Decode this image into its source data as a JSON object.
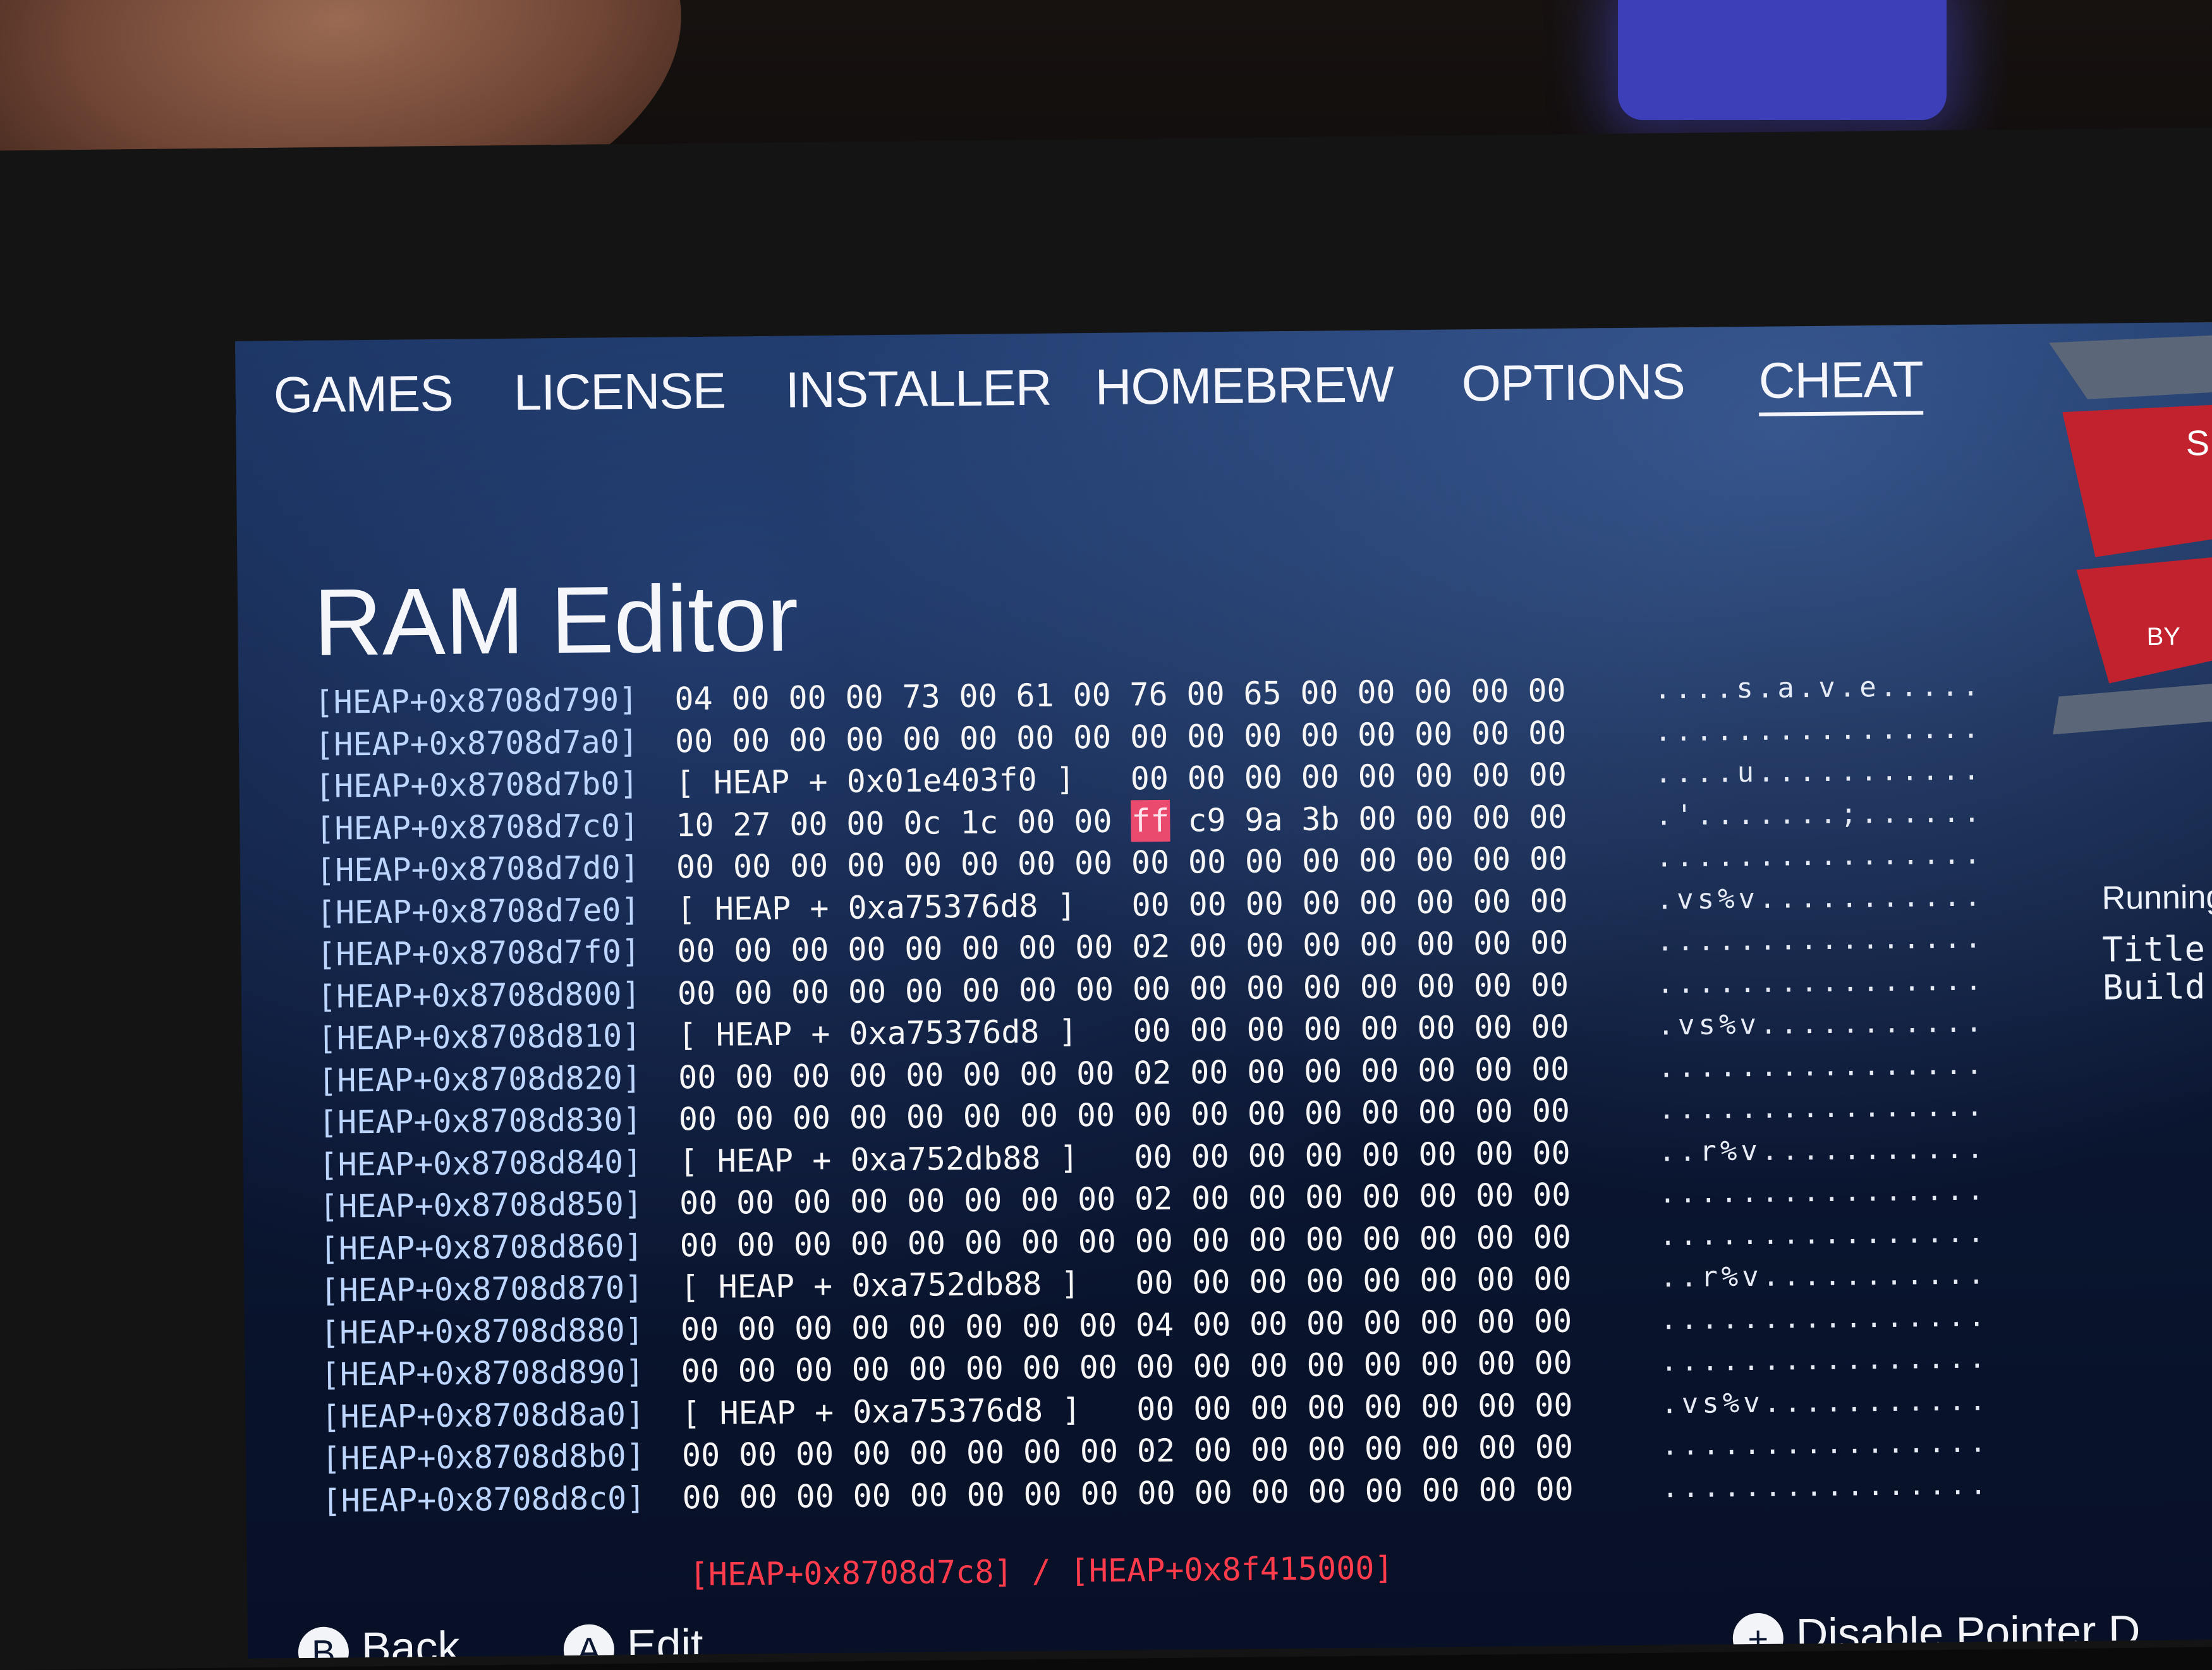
{
  "tabs": [
    {
      "label": "GAMES",
      "active": false
    },
    {
      "label": "LICENSE",
      "active": false
    },
    {
      "label": "INSTALLER",
      "active": false
    },
    {
      "label": "HOMEBREW",
      "active": false
    },
    {
      "label": "OPTIONS",
      "active": false
    },
    {
      "label": "CHEAT",
      "active": true
    }
  ],
  "page_title": "RAM Editor",
  "side_panel": {
    "logo_text_partial": "S",
    "logo_sub_partial": "BY",
    "running_label": "Running",
    "title_label": "Title",
    "build_label": "Build"
  },
  "hex_rows": [
    {
      "addr": "[HEAP+0x8708d790]",
      "bytes": [
        "04",
        "00",
        "00",
        "00",
        "73",
        "00",
        "61",
        "00",
        "76",
        "00",
        "65",
        "00",
        "00",
        "00",
        "00",
        "00"
      ],
      "ascii": "....s.a.v.e....."
    },
    {
      "addr": "[HEAP+0x8708d7a0]",
      "bytes": [
        "00",
        "00",
        "00",
        "00",
        "00",
        "00",
        "00",
        "00",
        "00",
        "00",
        "00",
        "00",
        "00",
        "00",
        "00",
        "00"
      ],
      "ascii": "................"
    },
    {
      "addr": "[HEAP+0x8708d7b0]",
      "pointer": "[  HEAP + 0x01e403f0  ]",
      "bytes": [
        "00",
        "00",
        "00",
        "00",
        "00",
        "00",
        "00",
        "00"
      ],
      "ascii": "....u..........."
    },
    {
      "addr": "[HEAP+0x8708d7c0]",
      "bytes": [
        "10",
        "27",
        "00",
        "00",
        "0c",
        "1c",
        "00",
        "00",
        "ff",
        "c9",
        "9a",
        "3b",
        "00",
        "00",
        "00",
        "00"
      ],
      "selected_index": 8,
      "ascii": ".'.......;......",
      "ascii_selected_index": 8
    },
    {
      "addr": "[HEAP+0x8708d7d0]",
      "bytes": [
        "00",
        "00",
        "00",
        "00",
        "00",
        "00",
        "00",
        "00",
        "00",
        "00",
        "00",
        "00",
        "00",
        "00",
        "00",
        "00"
      ],
      "ascii": "................"
    },
    {
      "addr": "[HEAP+0x8708d7e0]",
      "pointer": "[  HEAP + 0xa75376d8  ]",
      "bytes": [
        "00",
        "00",
        "00",
        "00",
        "00",
        "00",
        "00",
        "00"
      ],
      "ascii": ".vs%v..........."
    },
    {
      "addr": "[HEAP+0x8708d7f0]",
      "bytes": [
        "00",
        "00",
        "00",
        "00",
        "00",
        "00",
        "00",
        "00",
        "02",
        "00",
        "00",
        "00",
        "00",
        "00",
        "00",
        "00"
      ],
      "ascii": "................"
    },
    {
      "addr": "[HEAP+0x8708d800]",
      "bytes": [
        "00",
        "00",
        "00",
        "00",
        "00",
        "00",
        "00",
        "00",
        "00",
        "00",
        "00",
        "00",
        "00",
        "00",
        "00",
        "00"
      ],
      "ascii": "................"
    },
    {
      "addr": "[HEAP+0x8708d810]",
      "pointer": "[  HEAP + 0xa75376d8  ]",
      "bytes": [
        "00",
        "00",
        "00",
        "00",
        "00",
        "00",
        "00",
        "00"
      ],
      "ascii": ".vs%v..........."
    },
    {
      "addr": "[HEAP+0x8708d820]",
      "bytes": [
        "00",
        "00",
        "00",
        "00",
        "00",
        "00",
        "00",
        "00",
        "02",
        "00",
        "00",
        "00",
        "00",
        "00",
        "00",
        "00"
      ],
      "ascii": "................"
    },
    {
      "addr": "[HEAP+0x8708d830]",
      "bytes": [
        "00",
        "00",
        "00",
        "00",
        "00",
        "00",
        "00",
        "00",
        "00",
        "00",
        "00",
        "00",
        "00",
        "00",
        "00",
        "00"
      ],
      "ascii": "................"
    },
    {
      "addr": "[HEAP+0x8708d840]",
      "pointer": "[  HEAP + 0xa752db88  ]",
      "bytes": [
        "00",
        "00",
        "00",
        "00",
        "00",
        "00",
        "00",
        "00"
      ],
      "ascii": "..r%v..........."
    },
    {
      "addr": "[HEAP+0x8708d850]",
      "bytes": [
        "00",
        "00",
        "00",
        "00",
        "00",
        "00",
        "00",
        "00",
        "02",
        "00",
        "00",
        "00",
        "00",
        "00",
        "00",
        "00"
      ],
      "ascii": "................"
    },
    {
      "addr": "[HEAP+0x8708d860]",
      "bytes": [
        "00",
        "00",
        "00",
        "00",
        "00",
        "00",
        "00",
        "00",
        "00",
        "00",
        "00",
        "00",
        "00",
        "00",
        "00",
        "00"
      ],
      "ascii": "................"
    },
    {
      "addr": "[HEAP+0x8708d870]",
      "pointer": "[  HEAP + 0xa752db88  ]",
      "bytes": [
        "00",
        "00",
        "00",
        "00",
        "00",
        "00",
        "00",
        "00"
      ],
      "ascii": "..r%v..........."
    },
    {
      "addr": "[HEAP+0x8708d880]",
      "bytes": [
        "00",
        "00",
        "00",
        "00",
        "00",
        "00",
        "00",
        "00",
        "04",
        "00",
        "00",
        "00",
        "00",
        "00",
        "00",
        "00"
      ],
      "ascii": "................"
    },
    {
      "addr": "[HEAP+0x8708d890]",
      "bytes": [
        "00",
        "00",
        "00",
        "00",
        "00",
        "00",
        "00",
        "00",
        "00",
        "00",
        "00",
        "00",
        "00",
        "00",
        "00",
        "00"
      ],
      "ascii": "................"
    },
    {
      "addr": "[HEAP+0x8708d8a0]",
      "pointer": "[  HEAP + 0xa75376d8  ]",
      "bytes": [
        "00",
        "00",
        "00",
        "00",
        "00",
        "00",
        "00",
        "00"
      ],
      "ascii": ".vs%v..........."
    },
    {
      "addr": "[HEAP+0x8708d8b0]",
      "bytes": [
        "00",
        "00",
        "00",
        "00",
        "00",
        "00",
        "00",
        "00",
        "02",
        "00",
        "00",
        "00",
        "00",
        "00",
        "00",
        "00"
      ],
      "ascii": "................"
    },
    {
      "addr": "[HEAP+0x8708d8c0]",
      "bytes": [
        "00",
        "00",
        "00",
        "00",
        "00",
        "00",
        "00",
        "00",
        "00",
        "00",
        "00",
        "00",
        "00",
        "00",
        "00",
        "00"
      ],
      "ascii": "................"
    }
  ],
  "status_line": "[HEAP+0x8708d7c8] / [HEAP+0x8f415000]",
  "footer": {
    "back_glyph": "B",
    "back_label": "Back",
    "edit_glyph": "A",
    "edit_label": "Edit",
    "plus_glyph": "+",
    "disable_label": "Disable Pointer D"
  },
  "colors": {
    "selection": "#e94a6e",
    "status_text": "#ff3b4c",
    "address_text": "#bcd6ff"
  }
}
